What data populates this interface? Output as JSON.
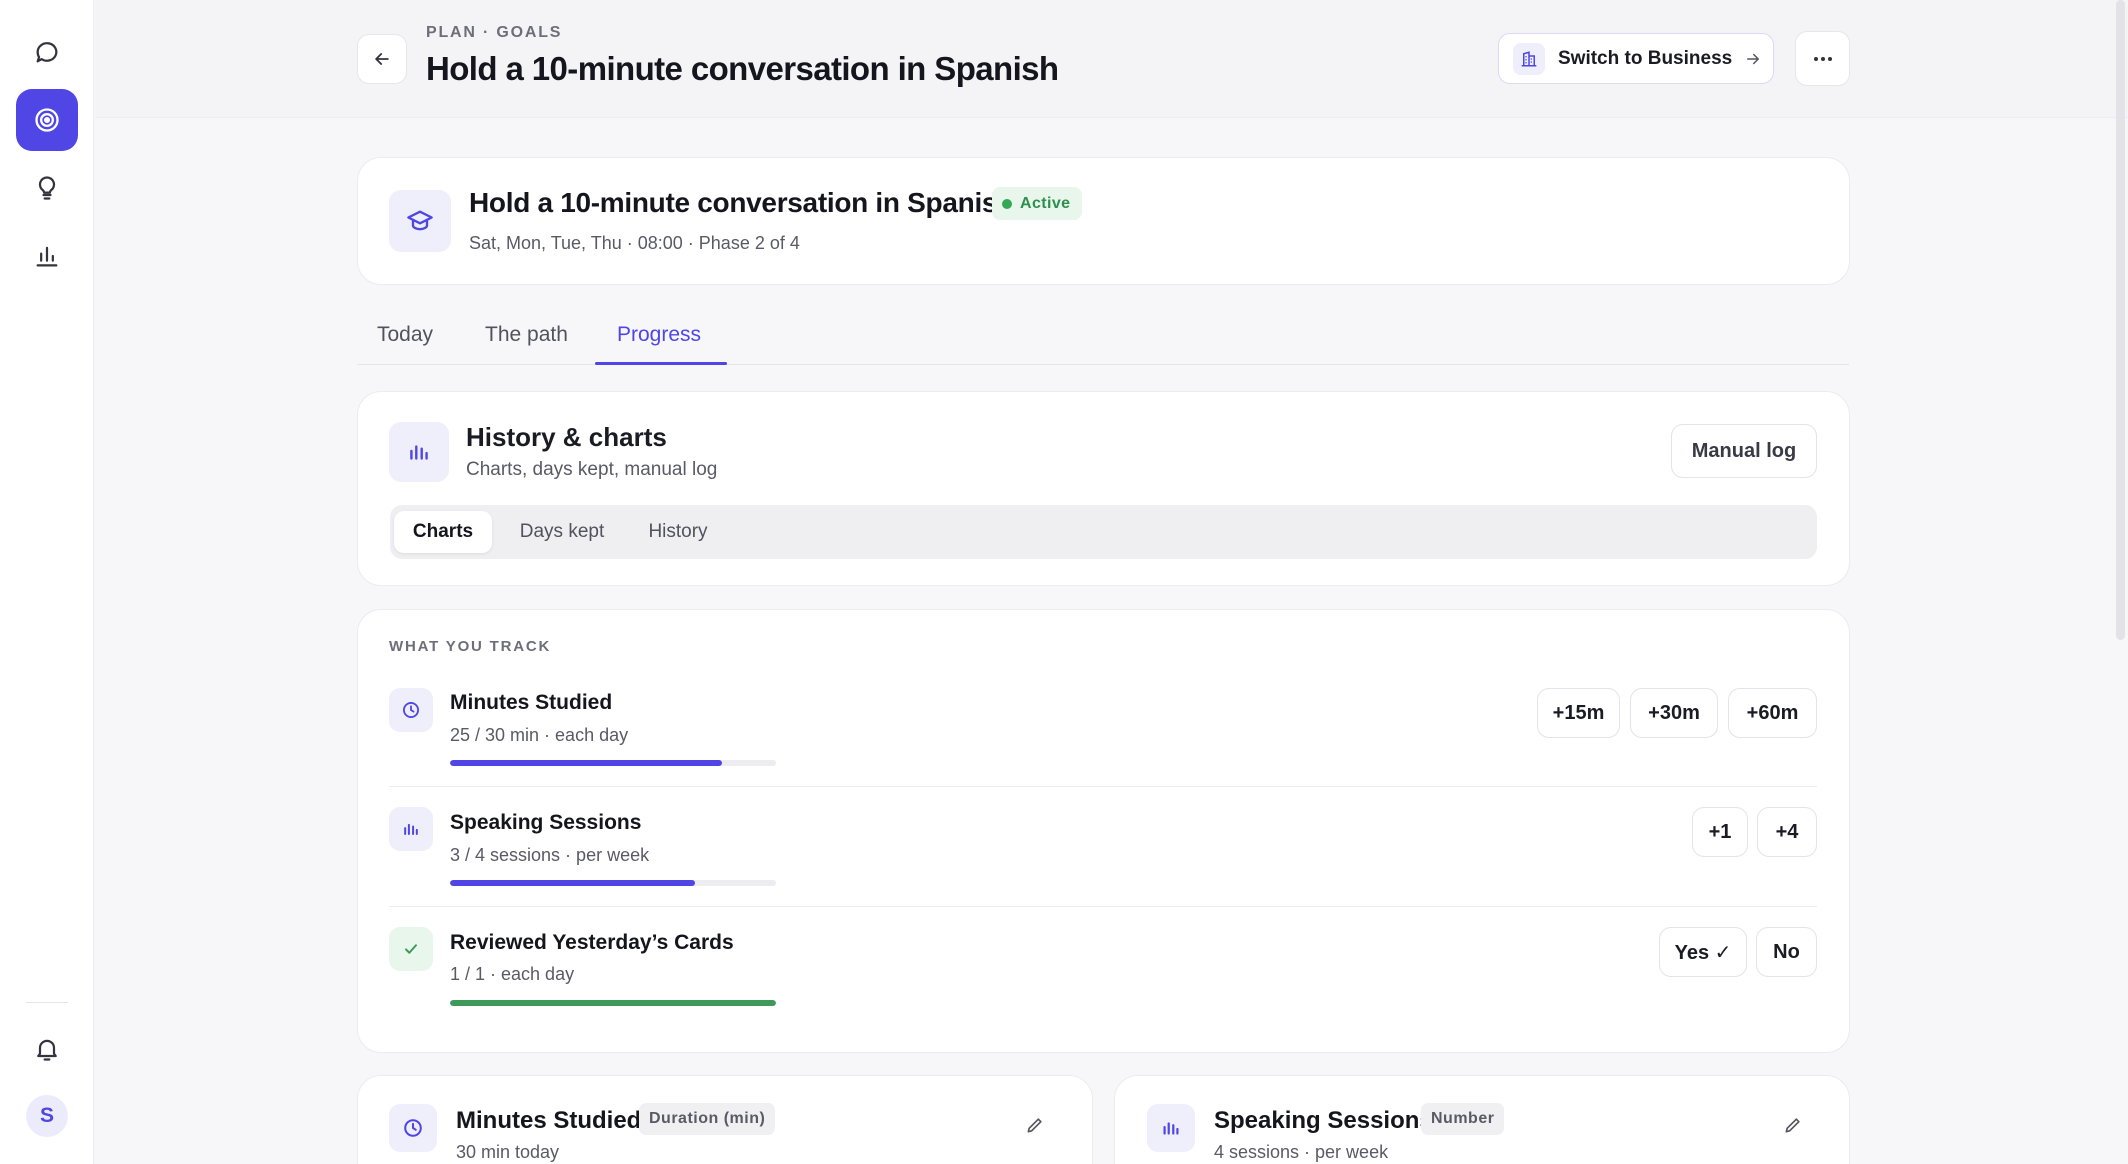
{
  "header": {
    "breadcrumb": "PLAN · GOALS",
    "title": "Hold a 10-minute conversation in Spanish",
    "switch_label": "Switch to Business"
  },
  "sidebar": {
    "items": [
      {
        "name": "chat",
        "icon": "chat-bubble-icon"
      },
      {
        "name": "goals",
        "icon": "target-icon",
        "active": true
      },
      {
        "name": "ideas",
        "icon": "lightbulb-icon"
      },
      {
        "name": "stats",
        "icon": "bar-chart-icon"
      }
    ],
    "avatar_initial": "S"
  },
  "goal": {
    "title": "Hold a 10-minute conversation in Spanish",
    "status": "Active",
    "schedule": "Sat, Mon, Tue, Thu · 08:00 · Phase 2 of 4"
  },
  "tabs": [
    {
      "label": "Today"
    },
    {
      "label": "The path"
    },
    {
      "label": "Progress",
      "active": true
    }
  ],
  "history": {
    "title": "History & charts",
    "subtitle": "Charts, days kept, manual log",
    "manual_button": "Manual log",
    "segments": [
      {
        "label": "Charts",
        "active": true
      },
      {
        "label": "Days kept"
      },
      {
        "label": "History"
      }
    ]
  },
  "tracking": {
    "section_label": "WHAT YOU TRACK",
    "metrics": [
      {
        "name": "Minutes Studied",
        "detail": "25 / 30 min · each day",
        "progress": 0.833,
        "icon": "clock-icon",
        "actions": [
          "+15m",
          "+30m",
          "+60m"
        ]
      },
      {
        "name": "Speaking Sessions",
        "detail": "3 / 4 sessions · per week",
        "progress": 0.75,
        "icon": "bar-chart-icon",
        "actions": [
          "+1",
          "+4"
        ]
      },
      {
        "name": "Reviewed Yesterday’s Cards",
        "detail": "1 / 1 · each day",
        "progress": 1.0,
        "icon": "check-icon",
        "actions": [
          "Yes ✓",
          "No"
        ]
      }
    ]
  },
  "metric_cards": [
    {
      "title": "Minutes Studied",
      "type": "Duration (min)",
      "summary": "30 min today",
      "icon": "clock-icon"
    },
    {
      "title": "Speaking Sessions",
      "type": "Number",
      "summary": "4 sessions · per week",
      "icon": "bar-chart-icon"
    }
  ],
  "colors": {
    "accent": "#4f46e5",
    "success": "#3f9a5a",
    "active_badge_bg": "#e8f6ec"
  }
}
